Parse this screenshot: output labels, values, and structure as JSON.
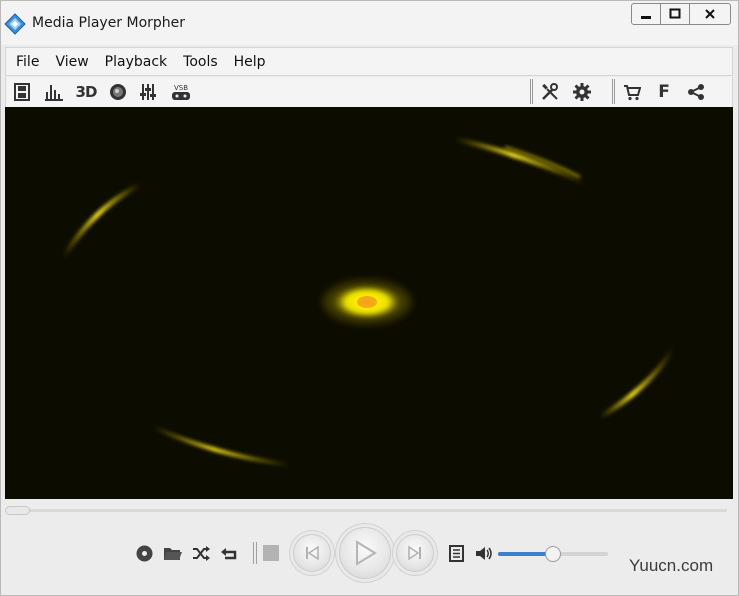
{
  "window": {
    "title": "Media Player Morpher"
  },
  "window_controls": {
    "minimize": "▬",
    "maximize": "□",
    "close": "✕"
  },
  "menu": [
    "File",
    "View",
    "Playback",
    "Tools",
    "Help"
  ],
  "toolbar_left": [
    {
      "icon": "filmstrip-icon"
    },
    {
      "icon": "spectrum-bars-icon"
    },
    {
      "icon": "3d-icon",
      "label": "3D"
    },
    {
      "icon": "sphere-icon"
    },
    {
      "icon": "equalizer-icon"
    },
    {
      "icon": "vsb-icon",
      "label": "VSB"
    }
  ],
  "toolbar_right": [
    {
      "icon": "tools-icon"
    },
    {
      "icon": "gear-icon"
    },
    {
      "icon": "cart-icon"
    },
    {
      "icon": "facebook-icon",
      "label": "F"
    },
    {
      "icon": "share-icon"
    }
  ],
  "playback": {
    "seek_position": 0,
    "volume": 0.5
  },
  "colors": {
    "video_background": "#0d0c00",
    "glow": "#f5e600",
    "volume_fill": "#3a7fd0"
  },
  "watermark": "Yuucn.com"
}
